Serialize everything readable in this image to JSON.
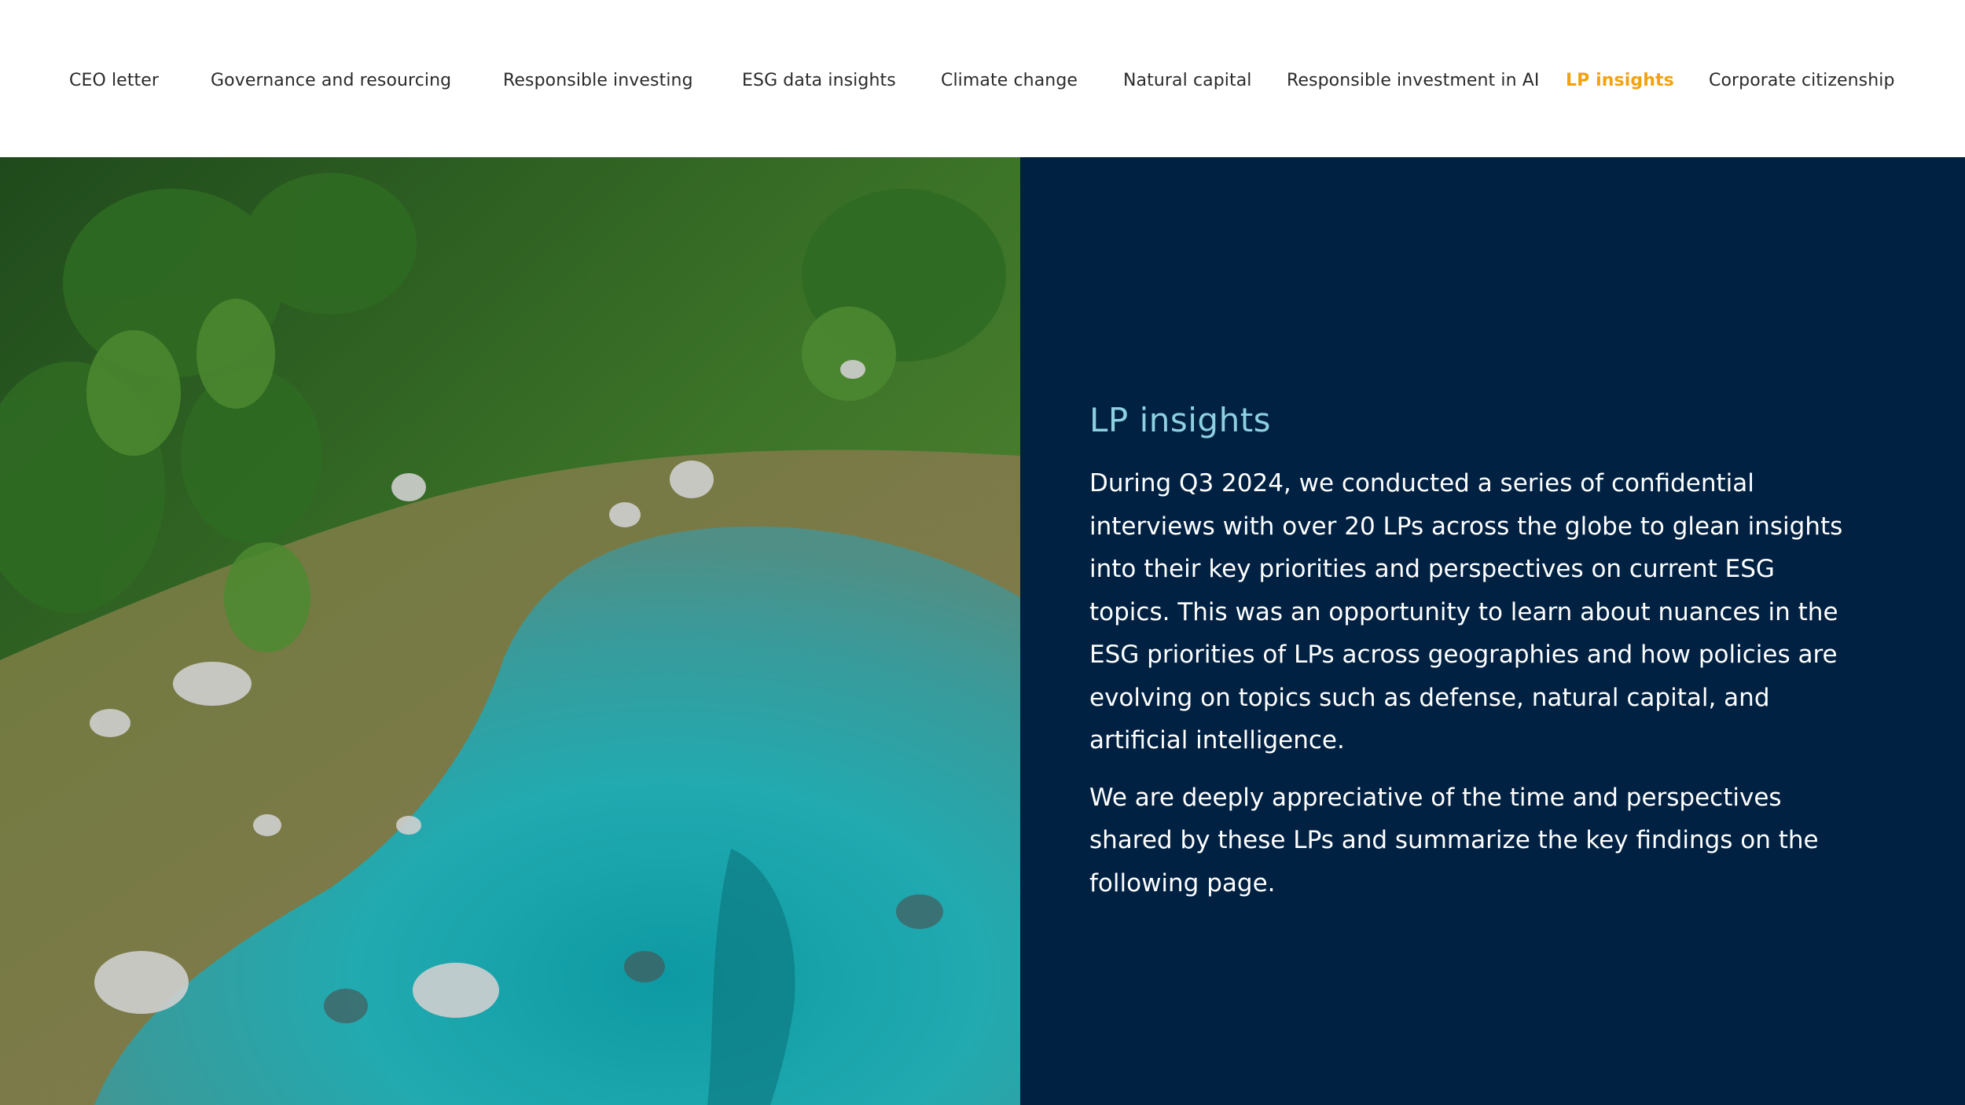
{
  "nav": {
    "items": [
      {
        "label": "CEO letter",
        "active": false
      },
      {
        "label": "Governance and resourcing",
        "active": false
      },
      {
        "label": "Responsible investing",
        "active": false
      },
      {
        "label": "ESG data insights",
        "active": false
      },
      {
        "label": "Climate change",
        "active": false
      },
      {
        "label": "Natural capital",
        "active": false
      },
      {
        "label": "Responsible investment in AI",
        "active": false
      },
      {
        "label": "LP insights",
        "active": true
      },
      {
        "label": "Corporate citizenship",
        "active": false
      }
    ]
  },
  "main": {
    "title": "LP insights",
    "paragraphs": [
      "During Q3 2024, we conducted a series of confidential interviews with over 20 LPs across the globe to glean insights into their key priorities and perspectives on current ESG topics. This was an opportunity to learn about nuances in the ESG priorities of LPs across geographies and how policies are evolving on topics such as defense, natural capital, and artificial intelligence.",
      "We are deeply appreciative of the time and perspectives shared by these LPs and summarize the key findings on the following page."
    ]
  },
  "colors": {
    "panel_background": "#002142",
    "title": "#8ed0e2",
    "body_text": "#ffffff",
    "nav_text": "#2a2a2a",
    "nav_active": "#f2a20e"
  }
}
